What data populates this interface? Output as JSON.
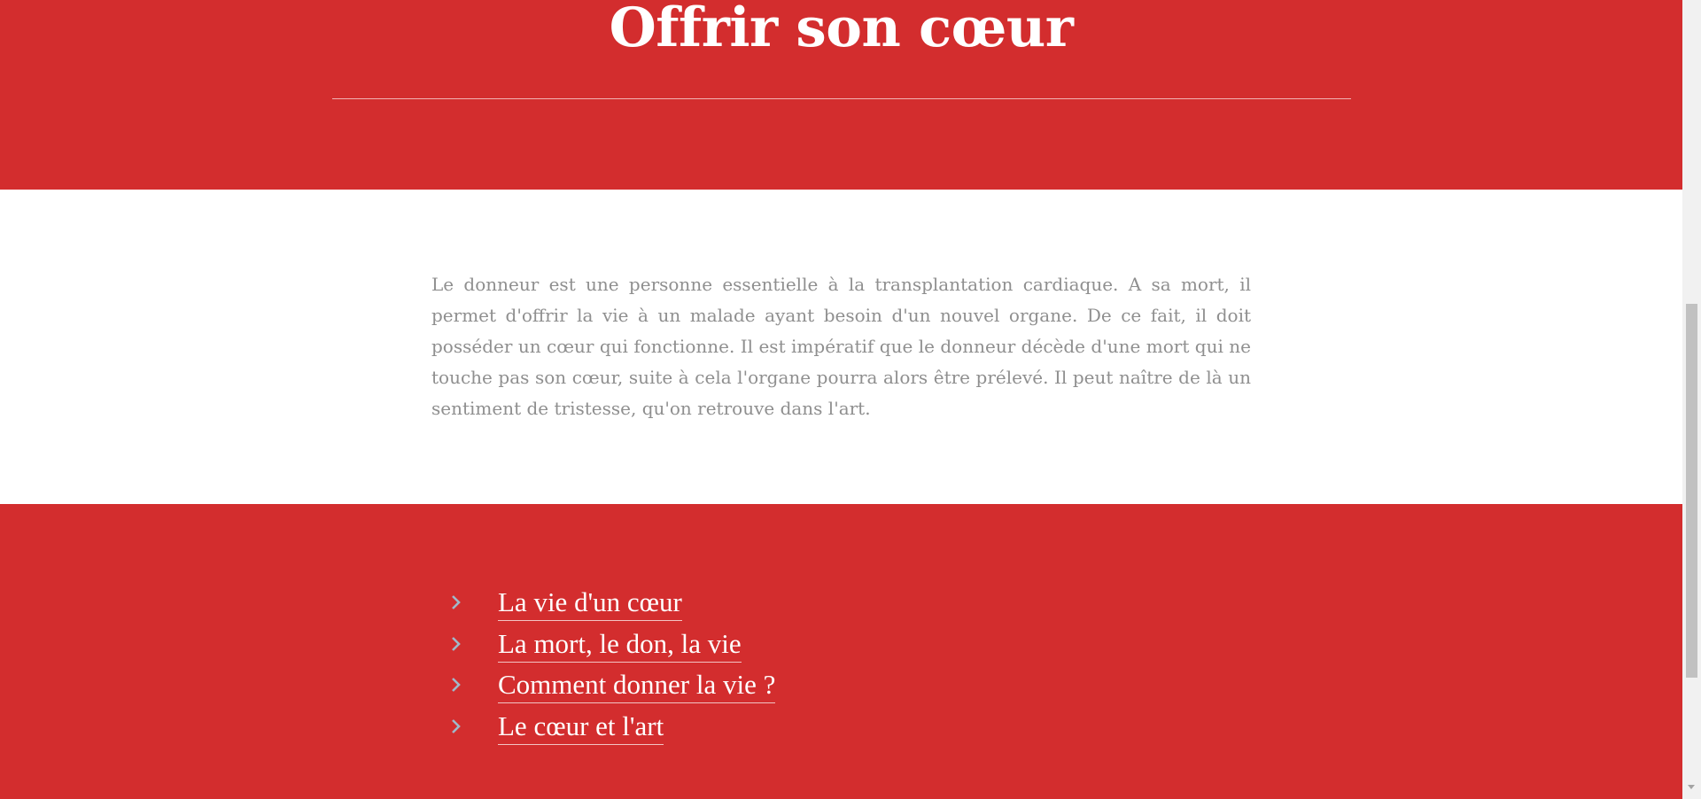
{
  "hero": {
    "title": "Offrir son cœur"
  },
  "intro": {
    "text": "Le donneur est une personne essentielle à la transplantation cardiaque. A sa mort, il permet d'offrir la vie à un malade ayant besoin d'un nouvel organe. De ce fait, il doit posséder un cœur qui fonctionne. Il est impératif que le donneur décède d'une mort qui ne touche pas son cœur, suite à cela l'organe pourra alors être prélevé. Il peut naître de là un sentiment de tristesse, qu'on retrouve dans l'art."
  },
  "nav": {
    "items": [
      {
        "label": "La vie d'un cœur",
        "icon": "chevron-right-icon"
      },
      {
        "label": "La mort, le don, la vie",
        "icon": "chevron-right-icon"
      },
      {
        "label": "Comment donner la vie ?",
        "icon": "chevron-right-icon"
      },
      {
        "label": "Le cœur et l'art",
        "icon": "chevron-right-icon"
      }
    ]
  },
  "colors": {
    "brand_red": "#d32d2e",
    "body_text": "#8f8f8f",
    "chevron": "#9fb8c9",
    "white": "#ffffff"
  }
}
